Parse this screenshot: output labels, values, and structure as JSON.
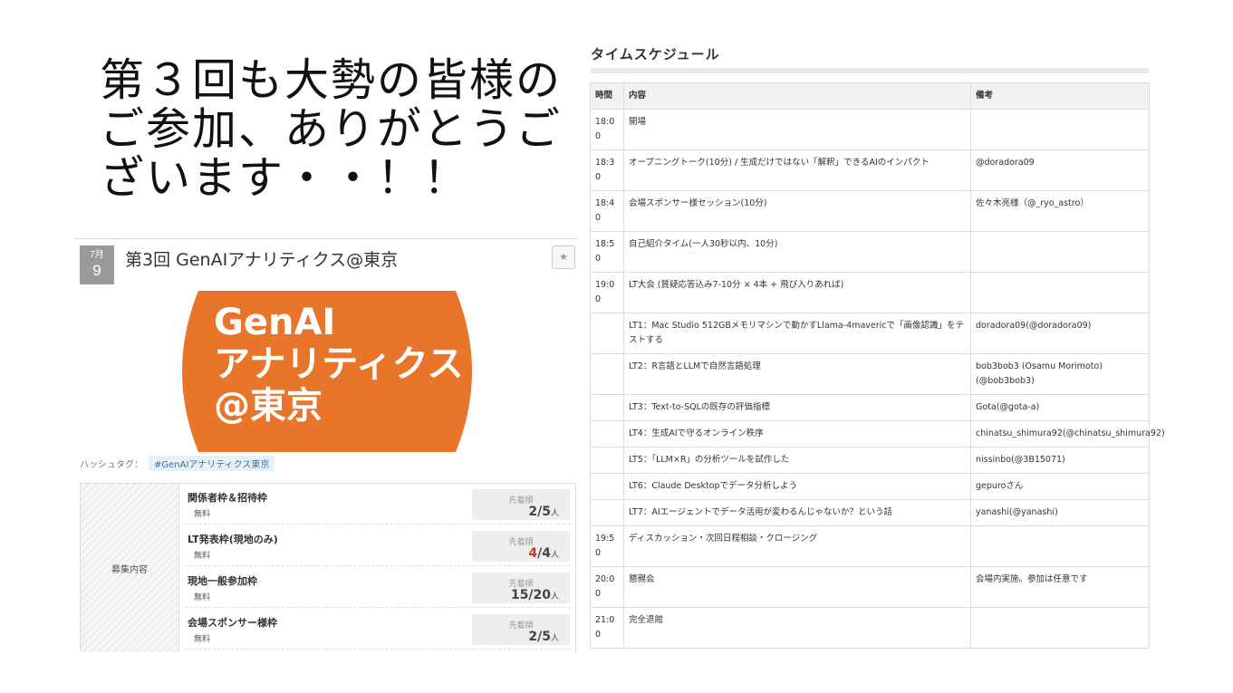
{
  "headline": {
    "lines": [
      "第３回も大勢の皆様の",
      "ご参加、ありがとうご",
      "ざいます・・！！"
    ]
  },
  "event": {
    "month": "7月",
    "day": "9",
    "title": "第3回 GenAIアナリティクス@東京",
    "favorite_icon": "star-icon",
    "banner": {
      "lines": [
        "GenAI",
        "アナリティクス",
        "@東京"
      ],
      "color": "#E8752A"
    },
    "hashtag_label": "ハッシュタグ：",
    "hashtag": "#GenAIアナリティクス東京",
    "recruit_label": "募集内容",
    "tickets": [
      {
        "name": "関係者枠＆招待枠",
        "price": "無料",
        "order": "先着順",
        "current": "2",
        "capacity": "/5",
        "unit": "人",
        "full": false
      },
      {
        "name": "LT発表枠(現地のみ)",
        "price": "無料",
        "order": "先着順",
        "current": "4",
        "capacity": "/4",
        "unit": "人",
        "full": true
      },
      {
        "name": "現地一般参加枠",
        "price": "無料",
        "order": "先着順",
        "current": "15",
        "capacity": "/20",
        "unit": "人",
        "full": false
      },
      {
        "name": "会場スポンサー様枠",
        "price": "無料",
        "order": "先着順",
        "current": "2",
        "capacity": "/5",
        "unit": "人",
        "full": false
      }
    ]
  },
  "schedule": {
    "title": "タイムスケジュール",
    "headers": [
      "時間",
      "内容",
      "備考"
    ],
    "rows": [
      {
        "time": "18:00",
        "content": "開場",
        "note": ""
      },
      {
        "time": "18:30",
        "content": "オープニングトーク(10分) / 生成だけではない「解釈」できるAIのインパクト",
        "note": "@doradora09"
      },
      {
        "time": "18:40",
        "content": "会場スポンサー様セッション(10分)",
        "note": "佐々木亮様（@_ryo_astro）"
      },
      {
        "time": "18:50",
        "content": "自己紹介タイム(一人30秒以内、10分)",
        "note": ""
      },
      {
        "time": "19:00",
        "content": "LT大会 (質疑応答込み7-10分 × 4本 + 飛び入りあれば)",
        "note": ""
      },
      {
        "time": "",
        "content": "LT1：Mac Studio 512GBメモリマシンで動かすLlama-4mavericで「画像認識」をテストする",
        "note": "doradora09(@doradora09)"
      },
      {
        "time": "",
        "content": "LT2：R言語とLLMで自然言語処理",
        "note": "bob3bob3 (Osamu Morimoto)(@bob3bob3)"
      },
      {
        "time": "",
        "content": "LT3：Text-to-SQLの既存の評価指標",
        "note": "Gota(@gota-a)"
      },
      {
        "time": "",
        "content": "LT4：生成AIで守るオンライン秩序",
        "note": "chinatsu_shimura92(@chinatsu_shimura92)"
      },
      {
        "time": "",
        "content": "LT5：「LLM×R」の分析ツールを試作した",
        "note": "nissinbo(@3B15071)"
      },
      {
        "time": "",
        "content": "LT6：Claude Desktopでデータ分析しよう",
        "note": "gepuroさん"
      },
      {
        "time": "",
        "content": "LT7：AIエージェントでデータ活用が変わるんじゃないか？という話",
        "note": "yanashi(@yanashi)"
      },
      {
        "time": "19:50",
        "content": "ディスカッション・次回日程相談・クロージング",
        "note": ""
      },
      {
        "time": "20:00",
        "content": "懇親会",
        "note": "会場内実施。参加は任意です"
      },
      {
        "time": "21:00",
        "content": "完全退館",
        "note": ""
      }
    ]
  }
}
